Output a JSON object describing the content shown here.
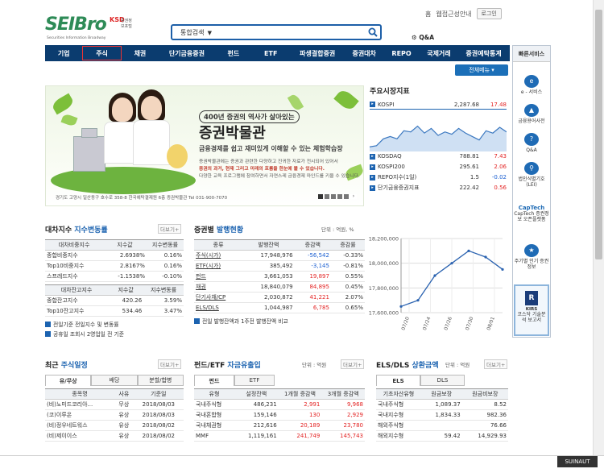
{
  "header": {
    "top_links": [
      "홈",
      "웹접근성안내"
    ],
    "login": "로그인",
    "logo": {
      "main": "SEIBro",
      "ksd": "KSD",
      "ksd_sub": "증권정보포털",
      "sub": "Securities Information Broadway"
    },
    "search_option": "통합검색",
    "search_placeholder": "",
    "qa": "Q&A"
  },
  "nav": {
    "items": [
      "기업",
      "주식",
      "채권",
      "단기금융증권",
      "펀드",
      "ETF",
      "파생결합증권",
      "증권대차",
      "REPO",
      "국제거래",
      "증권예탁통계"
    ],
    "selected": "주식",
    "all_menu": "전체메뉴 ▾"
  },
  "quick": {
    "title": "빠른서비스",
    "items": [
      {
        "label": "e - 서비스",
        "icon": "e-service-icon"
      },
      {
        "label": "금융용어사전",
        "icon": "dictionary-icon"
      },
      {
        "label": "Q&A",
        "icon": "qa-icon"
      },
      {
        "label": "법인식별기호 (LEI)",
        "icon": "lei-icon"
      },
      {
        "label": "CapTech 증권정보 오픈플랫폼",
        "icon": "captech-icon"
      },
      {
        "label": "주기별 인기 증권정보",
        "icon": "popular-icon"
      }
    ],
    "kirs": {
      "brand": "KIRS",
      "label": "코스닥 기술분석 보고서"
    }
  },
  "banner": {
    "tag": "400년 증권의 역사가 살아있는",
    "title": "증권박물관",
    "subtitle": "금융경제를 쉽고 재미있게 이해할 수 있는 체험학습장",
    "desc": [
      "증권박물관에는 증권과 관련한 다양하고 진귀한 자료가 전시되어 있어서",
      "증권의 과거, 현재 그리고 미래의 흐름을 한눈에 볼 수 있습니다.",
      "다양한 교육 프로그램에 참여하면서 자연스레 금융경제 마인드를 키울 수 있습니다."
    ],
    "address": "경기도 고양시 일산동구 호수로 358-8 한국예탁결제원 6층 증권박물관 Tel 031-900-7070"
  },
  "market": {
    "title": "주요시장지표",
    "rows": [
      {
        "name": "KOSPI",
        "value": "2,287.68",
        "change": "17.48",
        "dir": "up"
      },
      {
        "name": "KOSDAQ",
        "value": "788.81",
        "change": "7.43",
        "dir": "up"
      },
      {
        "name": "KOSPI200",
        "value": "295.61",
        "change": "2.06",
        "dir": "up"
      },
      {
        "name": "REPO지수(1일)",
        "value": "1.5",
        "change": "-0.02",
        "dir": "down"
      },
      {
        "name": "단기금융증권지표",
        "value": "222.42",
        "change": "0.56",
        "dir": "up"
      }
    ],
    "sparkline": [
      62,
      60,
      48,
      44,
      48,
      34,
      36,
      26,
      38,
      30,
      42,
      36,
      40,
      30,
      38,
      44,
      50,
      34,
      38,
      28,
      36
    ]
  },
  "lending": {
    "title_a": "대차지수",
    "title_b": " 지수변동률",
    "more": "더보기+",
    "head1": [
      "대차비중지수",
      "지수값",
      "지수변동률"
    ],
    "rows1": [
      [
        "종합비중지수",
        "2.6938%",
        "0.16%"
      ],
      [
        "Top10비중지수",
        "2.8167%",
        "0.16%"
      ],
      [
        "스프레드지수",
        "-1.1538%",
        "-0.10%"
      ]
    ],
    "head2": [
      "대차잔고지수",
      "지수값",
      "지수변동률"
    ],
    "rows2": [
      [
        "종합잔고지수",
        "420.26",
        "3.59%"
      ],
      [
        "Top10잔고지수",
        "534.46",
        "3.47%"
      ]
    ],
    "notes": [
      "전일기준 전일지수 및 변동률",
      "공휴일 조회시 2영업일 전 기준"
    ]
  },
  "issuance": {
    "title_a": "증권별",
    "title_b": " 발행현황",
    "unit": "단위 : 억원, %",
    "head": [
      "종류",
      "발행잔액",
      "증감액",
      "증감률"
    ],
    "rows": [
      [
        "주식(시가)",
        "17,948,976",
        "-56,542",
        "-0.33%"
      ],
      [
        "ETF(시가)",
        "385,492",
        "-3,145",
        "-0.81%"
      ],
      [
        "펀드",
        "3,661,053",
        "19,897",
        "0.55%"
      ],
      [
        "채권",
        "18,840,079",
        "84,895",
        "0.45%"
      ],
      [
        "단기사채/CP",
        "2,030,872",
        "41,221",
        "2.07%"
      ],
      [
        "ELS/DLS",
        "1,044,987",
        "6,785",
        "0.65%"
      ]
    ],
    "note": "전일 발행잔액과 1주전 발행잔액 비교"
  },
  "chart_data": {
    "type": "line",
    "x": [
      "07/20",
      "07/24",
      "07/26",
      "07/30",
      "08/01"
    ],
    "y": [
      17650000,
      17700000,
      17900000,
      18000000,
      18100000,
      18050000,
      17950000
    ],
    "ylim": [
      17600000,
      18200000
    ],
    "yticks": [
      "18,200,000",
      "18,000,000",
      "17,800,000",
      "17,600,000"
    ],
    "grid": true
  },
  "schedule": {
    "title_a": "최근",
    "title_b": " 주식일정",
    "more": "더보기+",
    "tabs": [
      "유/무상",
      "배당",
      "분할/합병"
    ],
    "head": [
      "종목명",
      "사유",
      "기준일"
    ],
    "rows": [
      [
        "(비)노미드코리아...",
        "무상",
        "2018/08/03"
      ],
      [
        "(코)이루온",
        "유상",
        "2018/08/03"
      ],
      [
        "(비)정우네트워스",
        "유상",
        "2018/08/02"
      ],
      [
        "(비)제이이스",
        "유상",
        "2018/08/02"
      ]
    ]
  },
  "fund": {
    "title_a": "펀드/ETF",
    "title_b": " 자금유출입",
    "unit": "단위 : 억원",
    "more": "더보기+",
    "tabs": [
      "펀드",
      "ETF"
    ],
    "head": [
      "유형",
      "설정잔액",
      "1개월 증감액",
      "3개월 증감액"
    ],
    "rows": [
      [
        "국내주식형",
        "486,231",
        "2,991",
        "9,968"
      ],
      [
        "국내혼합형",
        "159,146",
        "130",
        "2,929"
      ],
      [
        "국내채권형",
        "212,616",
        "20,189",
        "23,780"
      ],
      [
        "MMF",
        "1,119,161",
        "241,749",
        "145,743"
      ]
    ]
  },
  "els": {
    "title_a": "ELS/DLS",
    "title_b": " 상환금액",
    "unit": "단위 : 억원",
    "more": "더보기+",
    "tabs": [
      "ELS",
      "DLS"
    ],
    "head": [
      "기초자산유형",
      "원금보장",
      "원금비보장"
    ],
    "rows": [
      [
        "국내주식형",
        "1,089.37",
        "8.52"
      ],
      [
        "국내지수형",
        "1,834.33",
        "982.36"
      ],
      [
        "해외주식형",
        "",
        "76.66"
      ],
      [
        "해외지수형",
        "59.42",
        "14,929.93"
      ]
    ]
  },
  "footer": {
    "badge": "SUINAUT"
  }
}
